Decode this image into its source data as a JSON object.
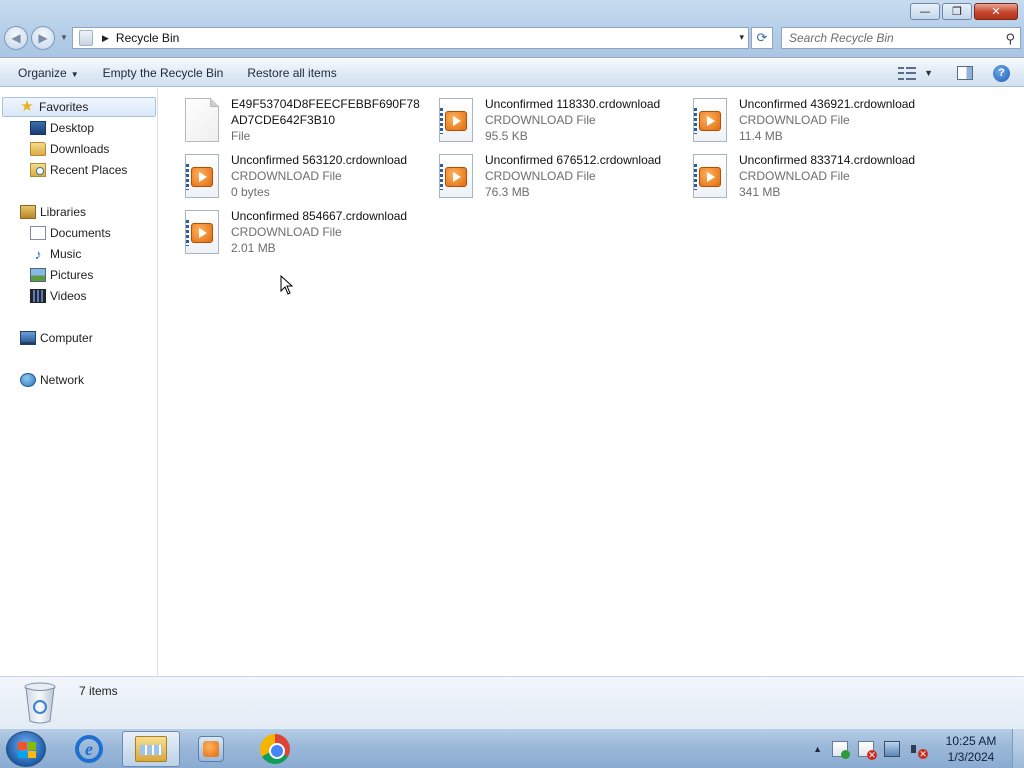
{
  "window": {
    "title_controls": {
      "minimize": "—",
      "restore": "❐",
      "close": "✕"
    }
  },
  "address_bar": {
    "path": [
      "Recycle Bin"
    ],
    "separator": "▶",
    "dropdown": "▾",
    "refresh": "⟳"
  },
  "search": {
    "placeholder": "Search Recycle Bin",
    "icon": "search-icon"
  },
  "toolbar": {
    "organize": "Organize",
    "organize_caret": "▼",
    "empty": "Empty the Recycle Bin",
    "restore": "Restore all items",
    "views_caret": "▼",
    "help": "?"
  },
  "navigation": {
    "favorites": {
      "label": "Favorites",
      "items": [
        "Desktop",
        "Downloads",
        "Recent Places"
      ]
    },
    "libraries": {
      "label": "Libraries",
      "items": [
        "Documents",
        "Music",
        "Pictures",
        "Videos"
      ]
    },
    "computer": "Computer",
    "network": "Network"
  },
  "files": [
    {
      "name": "E49F53704D8FEECFEBBF690F78AD7CDE642F3B10",
      "type": "File",
      "size": "",
      "icon": "blank-file-icon"
    },
    {
      "name": "Unconfirmed 118330.crdownload",
      "type": "CRDOWNLOAD File",
      "size": "95.5 KB",
      "icon": "media-file-icon"
    },
    {
      "name": "Unconfirmed 436921.crdownload",
      "type": "CRDOWNLOAD File",
      "size": "11.4 MB",
      "icon": "media-file-icon"
    },
    {
      "name": "Unconfirmed 563120.crdownload",
      "type": "CRDOWNLOAD File",
      "size": "0 bytes",
      "icon": "media-file-icon"
    },
    {
      "name": "Unconfirmed 676512.crdownload",
      "type": "CRDOWNLOAD File",
      "size": "76.3 MB",
      "icon": "media-file-icon"
    },
    {
      "name": "Unconfirmed 833714.crdownload",
      "type": "CRDOWNLOAD File",
      "size": "341 MB",
      "icon": "media-file-icon"
    },
    {
      "name": "Unconfirmed 854667.crdownload",
      "type": "CRDOWNLOAD File",
      "size": "2.01 MB",
      "icon": "media-file-icon"
    }
  ],
  "details": {
    "count": "7 items"
  },
  "taskbar": {
    "pinned": [
      "internet-explorer-icon",
      "windows-explorer-icon",
      "windows-media-player-icon",
      "chrome-icon"
    ],
    "tray_caret": "▲",
    "time": "10:25 AM",
    "date": "1/3/2024"
  }
}
